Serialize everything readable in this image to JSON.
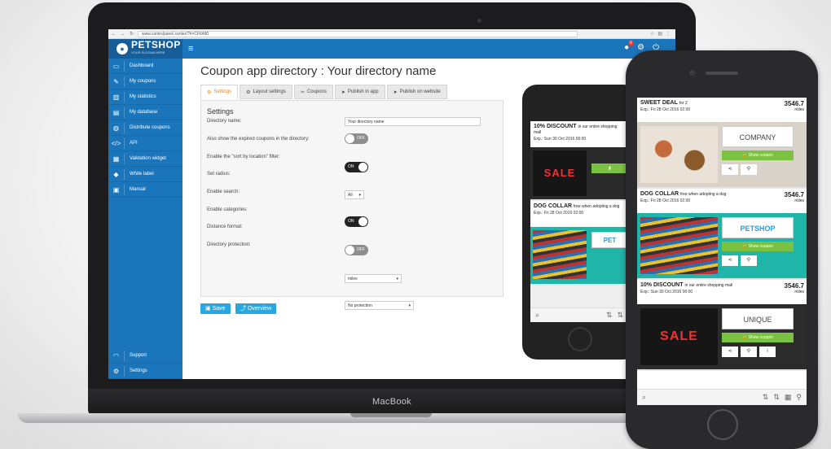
{
  "browser": {
    "url": "www.controlpanel.center/?h=CF6480"
  },
  "header": {
    "brand_name": "PETSHOP",
    "brand_tagline": "YOUR SLOGAN HERE",
    "notification_count": "6"
  },
  "sidebar": {
    "items": [
      {
        "label": "Dashboard",
        "icon": "monitor-icon",
        "glyph": "▭"
      },
      {
        "label": "My coupons",
        "icon": "paperclip-icon",
        "glyph": "✎"
      },
      {
        "label": "My statistics",
        "icon": "bar-chart-icon",
        "glyph": "▥"
      },
      {
        "label": "My database",
        "icon": "database-icon",
        "glyph": "▤"
      },
      {
        "label": "Distribute coupons",
        "icon": "share-icon",
        "glyph": "◍"
      },
      {
        "label": "API",
        "icon": "code-icon",
        "glyph": "</>"
      },
      {
        "label": "Validation widget",
        "icon": "barcode-icon",
        "glyph": "▦"
      },
      {
        "label": "White label",
        "icon": "tag-icon",
        "glyph": "◆"
      },
      {
        "label": "Manual",
        "icon": "book-icon",
        "glyph": "▣"
      }
    ],
    "bottom": [
      {
        "label": "Support",
        "icon": "headset-icon",
        "glyph": "◠"
      },
      {
        "label": "Settings",
        "icon": "gear-icon",
        "glyph": "⚙"
      }
    ]
  },
  "main": {
    "title": "Coupon app directory : Your directory name",
    "tabs": [
      {
        "label": "Settings",
        "icon": "gear-icon",
        "glyph": "⚙",
        "active": true
      },
      {
        "label": "Layout settings",
        "icon": "gear-icon",
        "glyph": "⚙",
        "active": false
      },
      {
        "label": "Coupons",
        "icon": "wrench-icon",
        "glyph": "✂",
        "active": false
      },
      {
        "label": "Publish in app",
        "icon": "send-icon",
        "glyph": "➤",
        "active": false
      },
      {
        "label": "Publish on website",
        "icon": "send-icon",
        "glyph": "➤",
        "active": false
      }
    ],
    "settings": {
      "heading": "Settings",
      "directory_name_label": "Directory name:",
      "directory_name_value": "Your directory name",
      "expired_label": "Also show the expired coupons in the directory:",
      "expired_state": "OFF",
      "sort_label": "Enable the \"sort by location\" filter:",
      "sort_state": "ON",
      "radius_label": "Set radius:",
      "radius_value": "All",
      "search_label": "Enable search:",
      "search_state": "ON",
      "categories_label": "Enable categories:",
      "categories_state": "OFF",
      "distance_label": "Distance format:",
      "distance_value": "miles",
      "protection_label": "Directory protection:",
      "protection_value": "No protection"
    },
    "save_label": "Save",
    "overview_label": "Overview"
  },
  "laptop": {
    "brand": "MacBook"
  },
  "phone_back": {
    "cards": [
      {
        "title": "10% DISCOUNT",
        "subtitle": "in our entire shopping mall",
        "expiry": "Exp.: Sun 30 Oct 2016 00:00",
        "image": "SALE"
      },
      {
        "title": "DOG COLLAR",
        "subtitle": "free when adopting a dog",
        "expiry": "Exp.: Fri 28 Oct 2016 02:00",
        "brand": "PET"
      }
    ]
  },
  "phone_front": {
    "cards": [
      {
        "title": "SWEET DEAL",
        "subtitle": "for 2",
        "expiry": "Exp.: Fri 28 Oct 2016 02:00",
        "distance": "3546.7",
        "unit": "miles",
        "brand": "COMPANY",
        "button": "Show coupon"
      },
      {
        "title": "DOG COLLAR",
        "subtitle": "free when adopting a dog",
        "expiry": "Exp.: Fri 28 Oct 2016 02:00",
        "distance": "3546.7",
        "unit": "miles",
        "brand": "PETSHOP",
        "button": "Show coupon"
      },
      {
        "title": "10% DISCOUNT",
        "subtitle": "in our entire shopping mall",
        "expiry": "Exp.: Sun 30 Oct 2016 00:00",
        "distance": "3546.7",
        "unit": "miles",
        "brand": "UNIQUE",
        "image": "SALE",
        "button": "Show coupon"
      }
    ]
  },
  "colors": {
    "primary": "#1b75bb",
    "accent": "#29a8e0",
    "tab_active": "#e8841c",
    "teal": "#1fb5a8",
    "green": "#7cc242"
  }
}
